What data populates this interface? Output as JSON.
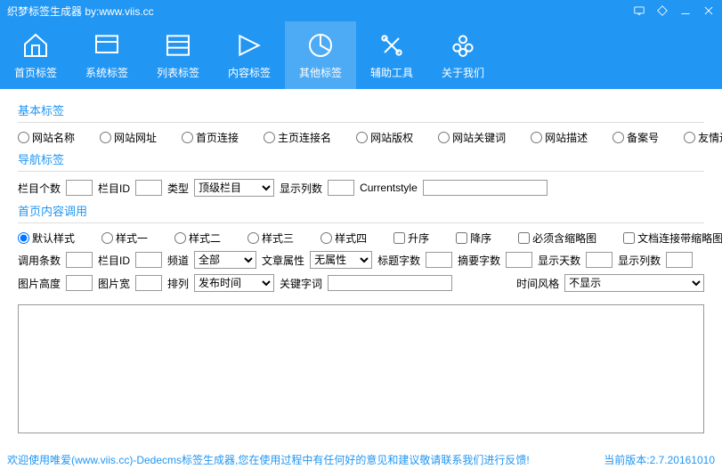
{
  "titlebar": {
    "title": "织梦标签生成器  by:www.viis.cc"
  },
  "toolbar": {
    "items": [
      {
        "label": "首页标签"
      },
      {
        "label": "系统标签"
      },
      {
        "label": "列表标签"
      },
      {
        "label": "内容标签"
      },
      {
        "label": "其他标签"
      },
      {
        "label": "辅助工具"
      },
      {
        "label": "关于我们"
      }
    ]
  },
  "sections": {
    "basic": {
      "title": "基本标签"
    },
    "nav": {
      "title": "导航标签"
    },
    "home": {
      "title": "首页内容调用"
    }
  },
  "basic_radios": [
    "网站名称",
    "网站网址",
    "首页连接",
    "主页连接名",
    "网站版权",
    "网站关键词",
    "网站描述",
    "备案号",
    "友情连接"
  ],
  "nav_labels": {
    "count": "栏目个数",
    "id": "栏目ID",
    "type": "类型",
    "type_opt": "顶级栏目",
    "cols": "显示列数",
    "curstyle": "Currentstyle"
  },
  "home_radios": [
    "默认样式",
    "样式一",
    "样式二",
    "样式三",
    "样式四"
  ],
  "home_checks": [
    "升序",
    "降序",
    "必须含缩略图",
    "文档连接带缩略图"
  ],
  "home_labels": {
    "rows": "调用条数",
    "colid": "栏目ID",
    "channel": "频道",
    "channel_opt": "全部",
    "attr": "文章属性",
    "attr_opt": "无属性",
    "titlelen": "标题字数",
    "infolen": "摘要字数",
    "days": "显示天数",
    "cols": "显示列数",
    "imgh": "图片高度",
    "imgw": "图片宽",
    "order": "排列",
    "order_opt": "发布时间",
    "keyword": "关键字词",
    "timestyle": "时间风格",
    "timestyle_opt": "不显示"
  },
  "footer": {
    "welcome": "欢迎使用唯爱(www.viis.cc)-Dedecms标签生成器,您在使用过程中有任何好的意见和建议敬请联系我们进行反馈!",
    "version": "当前版本:2.7.20161010"
  }
}
